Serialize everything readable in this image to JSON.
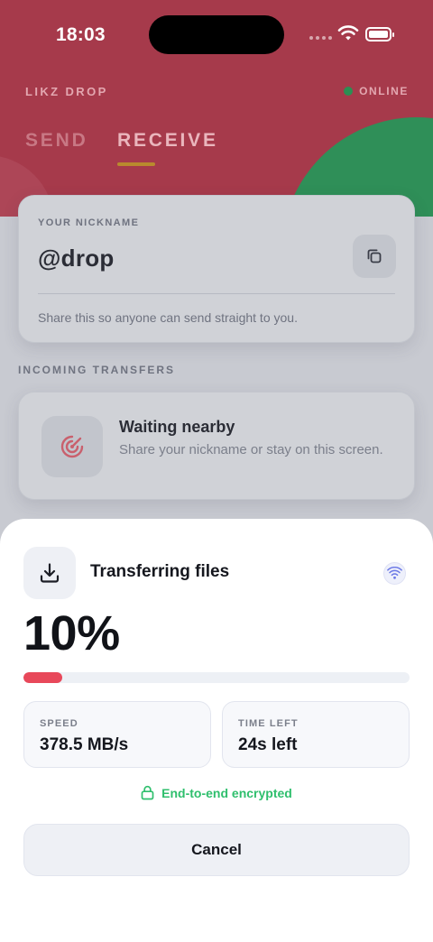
{
  "status_bar": {
    "time": "18:03"
  },
  "app": {
    "brand": "LIKZ DROP",
    "status": "ONLINE",
    "tabs": [
      {
        "label": "SEND",
        "active": false
      },
      {
        "label": "RECEIVE",
        "active": true
      }
    ]
  },
  "nickname_card": {
    "label": "YOUR NICKNAME",
    "value": "@drop",
    "help": "Share this so anyone can send straight to you."
  },
  "incoming": {
    "section_label": "INCOMING TRANSFERS",
    "title": "Waiting nearby",
    "subtitle": "Share your nickname or stay on this screen."
  },
  "transfer_sheet": {
    "title": "Transferring files",
    "percent_text": "10%",
    "progress": 0.1,
    "speed_label": "SPEED",
    "speed_value": "378.5 MB/s",
    "time_label": "TIME LEFT",
    "time_value": "24s left",
    "encryption": "End-to-end encrypted",
    "cancel_label": "Cancel"
  },
  "colors": {
    "header": "#a63a4b",
    "accent_green": "#2f8f58",
    "progress_fill": "#e8485a",
    "encrypted_green": "#2fbf6d"
  },
  "icons": [
    "copy-icon",
    "radar-icon",
    "download-icon",
    "wifi-icon",
    "lock-icon",
    "battery-icon"
  ]
}
